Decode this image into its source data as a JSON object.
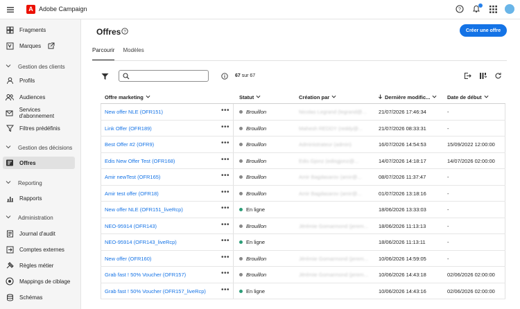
{
  "header": {
    "app_title": "Adobe Campaign",
    "logo_letter": "A"
  },
  "sidebar": {
    "items": [
      {
        "label": "Fragments",
        "icon": "fragments-icon"
      },
      {
        "label": "Marques",
        "icon": "brands-icon"
      },
      {
        "label": "Profils",
        "icon": "profile-icon"
      },
      {
        "label": "Audiences",
        "icon": "audiences-icon"
      },
      {
        "label": "Services d'abonnement",
        "icon": "subscription-icon"
      },
      {
        "label": "Filtres prédéfinis",
        "icon": "filter-icon"
      },
      {
        "label": "Offres",
        "icon": "offers-icon"
      },
      {
        "label": "Rapports",
        "icon": "reports-icon"
      },
      {
        "label": "Journal d'audit",
        "icon": "audit-icon"
      },
      {
        "label": "Comptes externes",
        "icon": "external-accounts-icon"
      },
      {
        "label": "Règles métier",
        "icon": "rules-icon"
      },
      {
        "label": "Mappings de ciblage",
        "icon": "mapping-icon"
      },
      {
        "label": "Schémas",
        "icon": "schema-icon"
      }
    ],
    "sections": [
      {
        "label": "Gestion des clients"
      },
      {
        "label": "Gestion des décisions"
      },
      {
        "label": "Reporting"
      },
      {
        "label": "Administration"
      }
    ]
  },
  "main": {
    "title": "Offres",
    "create_button": "Créer une offre",
    "tabs": [
      {
        "label": "Parcourir"
      },
      {
        "label": "Modèles"
      }
    ],
    "search_placeholder": "",
    "count_shown": "67",
    "count_text": "sur 67"
  },
  "table": {
    "columns": [
      {
        "label": "Offre marketing"
      },
      {
        "label": "Statut"
      },
      {
        "label": "Création par"
      },
      {
        "label": "Dernière modific..."
      },
      {
        "label": "Date de début"
      }
    ],
    "rows": [
      {
        "name": "New offer NLE (OFR151)",
        "status": "Brouillon",
        "creator": "Nicolas Legrand (legrand@...",
        "modified": "21/07/2026 17:46:34",
        "start": "-"
      },
      {
        "name": "Link Offer (OFR189)",
        "status": "Brouillon",
        "creator": "Mahesh REDDY (reddy@...",
        "modified": "21/07/2026 08:33:31",
        "start": "-"
      },
      {
        "name": "Best Offer #2 (OFR9)",
        "status": "Brouillon",
        "creator": "Administrateur (admin)",
        "modified": "16/07/2026 14:54:53",
        "start": "15/09/2022 12:00:00"
      },
      {
        "name": "Edis New Offer Test (OFR168)",
        "status": "Brouillon",
        "creator": "Edis Gjonz (edisgjonz@...",
        "modified": "14/07/2026 14:18:17",
        "start": "14/07/2026 02:00:00"
      },
      {
        "name": "Amir newTest (OFR165)",
        "status": "Brouillon",
        "creator": "Amir Bagdasarov (amir@...",
        "modified": "08/07/2026 11:37:47",
        "start": "-"
      },
      {
        "name": "Amir test offer (OFR18)",
        "status": "Brouillon",
        "creator": "Amir Bagdasarov (amir@...",
        "modified": "01/07/2026 13:18:16",
        "start": "-"
      },
      {
        "name": "New offer NLE (OFR151_liveRcp)",
        "status": "En ligne",
        "creator": "",
        "modified": "18/06/2026 13:33:03",
        "start": "-"
      },
      {
        "name": "NEO-95914 (OFR143)",
        "status": "Brouillon",
        "creator": "Jérémie Gomarmond (jerem...",
        "modified": "18/06/2026 11:13:13",
        "start": "-"
      },
      {
        "name": "NEO-95914 (OFR143_liveRcp)",
        "status": "En ligne",
        "creator": "",
        "modified": "18/06/2026 11:13:11",
        "start": "-"
      },
      {
        "name": "New offer (OFR160)",
        "status": "Brouillon",
        "creator": "Jérémie Gomarmond (jerem...",
        "modified": "10/06/2026 14:59:05",
        "start": "-"
      },
      {
        "name": "Grab fast ! 50% Voucher (OFR157)",
        "status": "Brouillon",
        "creator": "Jérémie Gomarmond (jerem...",
        "modified": "10/06/2026 14:43:18",
        "start": "02/06/2026 02:00:00"
      },
      {
        "name": "Grab fast ! 50% Voucher (OFR157_liveRcp)",
        "status": "En ligne",
        "creator": "",
        "modified": "10/06/2026 14:43:16",
        "start": "02/06/2026 02:00:00"
      }
    ]
  },
  "colors": {
    "accent": "#1473e6",
    "brand": "#eb1000",
    "status_draft": "#888888",
    "status_online": "#2d9d78"
  }
}
